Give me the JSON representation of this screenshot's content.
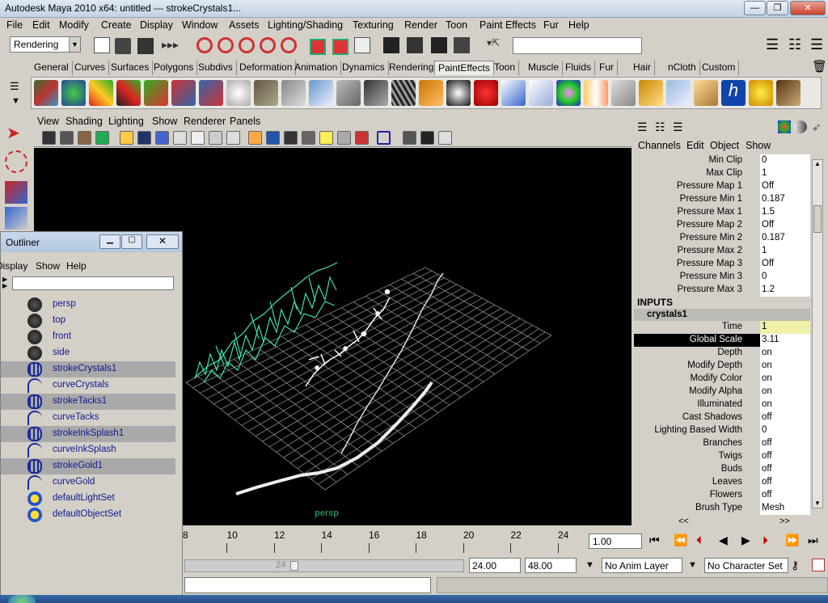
{
  "window": {
    "title": "Autodesk Maya 2010 x64: untitled   ---   strokeCrystals1..."
  },
  "menubar": [
    "File",
    "Edit",
    "Modify",
    "Create",
    "Display",
    "Window",
    "Assets",
    "Lighting/Shading",
    "Texturing",
    "Render",
    "Toon",
    "Paint Effects",
    "Fur",
    "Help"
  ],
  "statusline": {
    "menuset": "Rendering"
  },
  "shelf": {
    "tabs": [
      "General",
      "Curves",
      "Surfaces",
      "Polygons",
      "Subdivs",
      "Deformation",
      "Animation",
      "Dynamics",
      "Rendering",
      "PaintEffects",
      "Toon",
      "Muscle",
      "Fluids",
      "Fur",
      "Hair",
      "nCloth",
      "Custom"
    ],
    "active": "PaintEffects"
  },
  "viewport": {
    "menu": [
      "View",
      "Shading",
      "Lighting",
      "Show",
      "Renderer",
      "Panels"
    ],
    "camera_label": "persp"
  },
  "outliner": {
    "title": "Outliner",
    "menu": [
      "Display",
      "Show",
      "Help"
    ],
    "items": [
      {
        "label": "persp",
        "type": "camera",
        "selected": false
      },
      {
        "label": "top",
        "type": "camera",
        "selected": false
      },
      {
        "label": "front",
        "type": "camera",
        "selected": false
      },
      {
        "label": "side",
        "type": "camera",
        "selected": false
      },
      {
        "label": "strokeCrystals1",
        "type": "stroke",
        "selected": true
      },
      {
        "label": "curveCrystals",
        "type": "curve",
        "selected": false
      },
      {
        "label": "strokeTacks1",
        "type": "stroke",
        "selected": true
      },
      {
        "label": "curveTacks",
        "type": "curve",
        "selected": false
      },
      {
        "label": "strokeInkSplash1",
        "type": "stroke",
        "selected": true
      },
      {
        "label": "curveInkSplash",
        "type": "curve",
        "selected": false
      },
      {
        "label": "strokeGold1",
        "type": "stroke",
        "selected": true
      },
      {
        "label": "curveGold",
        "type": "curve",
        "selected": false
      },
      {
        "label": "defaultLightSet",
        "type": "set",
        "selected": false
      },
      {
        "label": "defaultObjectSet",
        "type": "set",
        "selected": false
      }
    ]
  },
  "channelbox": {
    "menu": [
      "Channels",
      "Edit",
      "Object",
      "Show"
    ],
    "attrs": [
      {
        "name": "Min Clip",
        "value": "0"
      },
      {
        "name": "Max Clip",
        "value": "1"
      },
      {
        "name": "Pressure Map 1",
        "value": "Off"
      },
      {
        "name": "Pressure Min 1",
        "value": "0.187"
      },
      {
        "name": "Pressure Max 1",
        "value": "1.5"
      },
      {
        "name": "Pressure Map 2",
        "value": "Off"
      },
      {
        "name": "Pressure Min 2",
        "value": "0.187"
      },
      {
        "name": "Pressure Max 2",
        "value": "1"
      },
      {
        "name": "Pressure Map 3",
        "value": "Off"
      },
      {
        "name": "Pressure Min 3",
        "value": "0"
      },
      {
        "name": "Pressure Max 3",
        "value": "1.2"
      }
    ],
    "inputs_label": "INPUTS",
    "node": "crystals1",
    "inputs": [
      {
        "name": "Time",
        "value": "1"
      },
      {
        "name": "Global Scale",
        "value": "3.11"
      },
      {
        "name": "Depth",
        "value": "on"
      },
      {
        "name": "Modify Depth",
        "value": "on"
      },
      {
        "name": "Modify Color",
        "value": "on"
      },
      {
        "name": "Modify Alpha",
        "value": "on"
      },
      {
        "name": "Illuminated",
        "value": "on"
      },
      {
        "name": "Cast Shadows",
        "value": "off"
      },
      {
        "name": "Lighting Based Width",
        "value": "0"
      },
      {
        "name": "Branches",
        "value": "off"
      },
      {
        "name": "Twigs",
        "value": "off"
      },
      {
        "name": "Buds",
        "value": "off"
      },
      {
        "name": "Leaves",
        "value": "off"
      },
      {
        "name": "Flowers",
        "value": "off"
      },
      {
        "name": "Brush Type",
        "value": "Mesh"
      }
    ],
    "scroll_left": "<<",
    "scroll_right": ">>"
  },
  "timeslider": {
    "ticks": [
      "8",
      "10",
      "12",
      "14",
      "16",
      "18",
      "20",
      "22",
      "24"
    ],
    "current_time": "1.00",
    "range_marker": "24"
  },
  "rangebar": {
    "start": "24.00",
    "end": "48.00",
    "anim_layer": "No Anim Layer",
    "character_set": "No Character Set"
  }
}
